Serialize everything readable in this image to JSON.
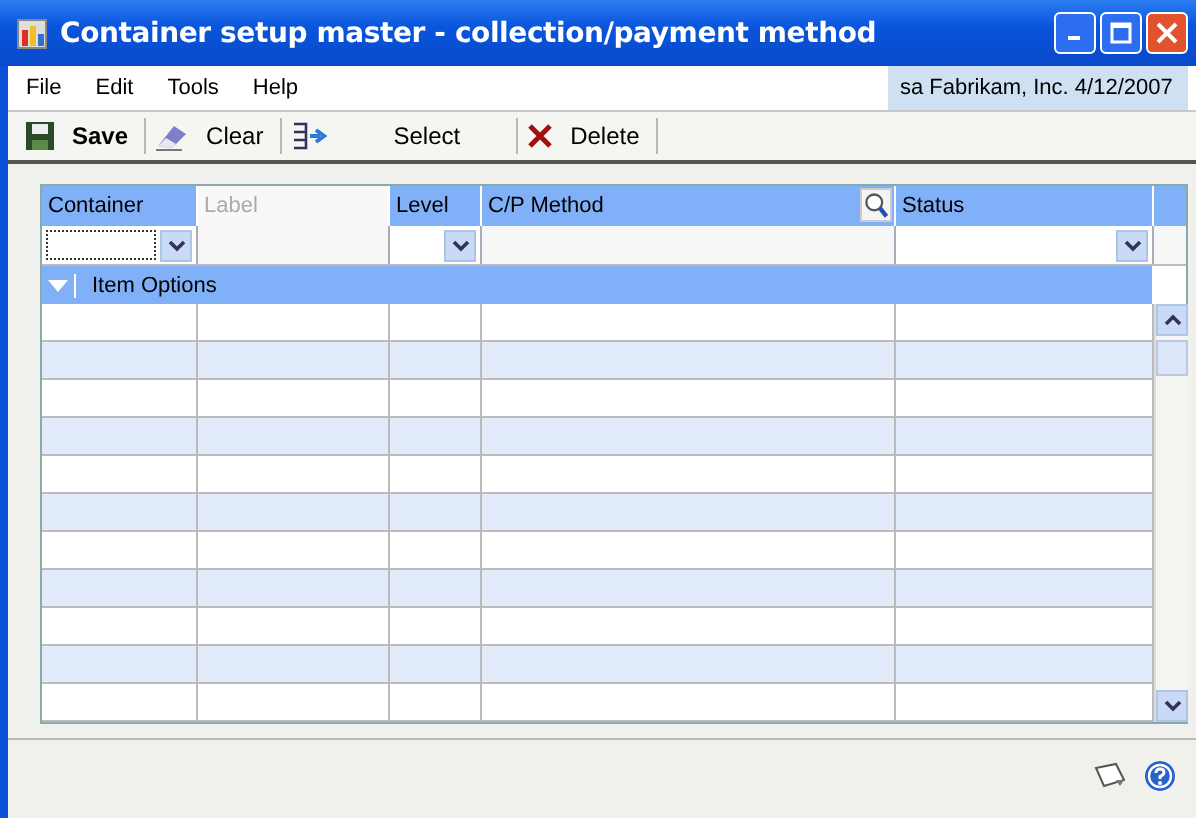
{
  "window": {
    "title": "Container setup master - collection/payment method"
  },
  "menu": [
    {
      "label": "File"
    },
    {
      "label": "Edit"
    },
    {
      "label": "Tools"
    },
    {
      "label": "Help"
    }
  ],
  "user_info": "sa  Fabrikam, Inc.  4/12/2007",
  "toolbar": [
    {
      "kind": "save",
      "label": "Save"
    },
    {
      "kind": "clear",
      "label": "Clear"
    },
    {
      "kind": "select",
      "label": "Select"
    },
    {
      "kind": "delete",
      "label": "Delete"
    }
  ],
  "table": {
    "columns": [
      {
        "label": "Container",
        "disabled": false,
        "lookup": false
      },
      {
        "label": "Label",
        "disabled": true,
        "lookup": false
      },
      {
        "label": "Level",
        "disabled": false,
        "lookup": false
      },
      {
        "label": "C/P Method",
        "disabled": false,
        "lookup": true
      },
      {
        "label": "Status",
        "disabled": false,
        "lookup": false
      }
    ],
    "filter_row": [
      {
        "kind": "dropdown",
        "focused": true
      },
      {
        "kind": "empty"
      },
      {
        "kind": "dropdown",
        "focused": false
      },
      {
        "kind": "empty"
      },
      {
        "kind": "dropdown",
        "focused": false
      }
    ],
    "band": {
      "label": "Item Options",
      "expanded": true
    },
    "rows": [
      {
        "shaded": false
      },
      {
        "shaded": true
      },
      {
        "shaded": false
      },
      {
        "shaded": true
      },
      {
        "shaded": false
      },
      {
        "shaded": true
      },
      {
        "shaded": false
      },
      {
        "shaded": true
      },
      {
        "shaded": false
      },
      {
        "shaded": true
      },
      {
        "shaded": false
      }
    ]
  }
}
